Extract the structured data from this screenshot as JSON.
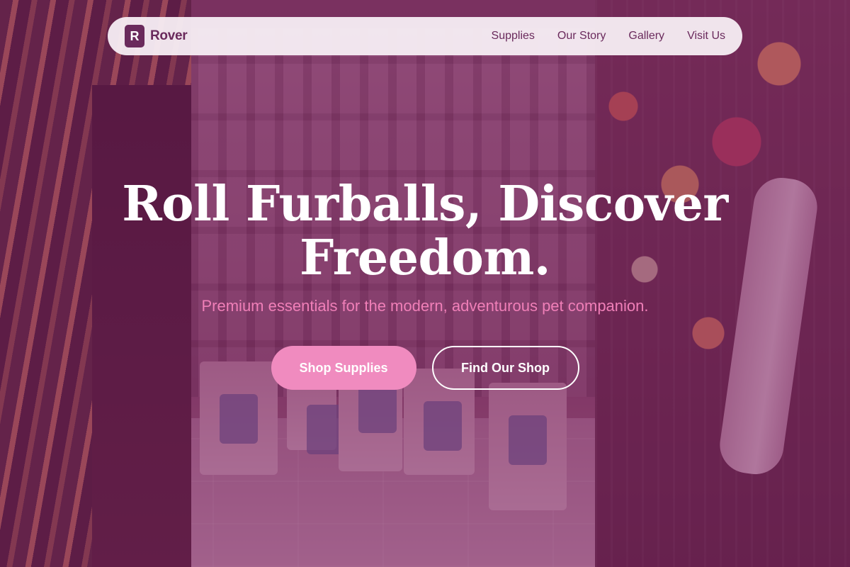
{
  "brand": {
    "logo_letter": "R",
    "name": "Rover"
  },
  "nav": {
    "links": [
      {
        "label": "Supplies"
      },
      {
        "label": "Our Story"
      },
      {
        "label": "Gallery"
      },
      {
        "label": "Visit Us"
      }
    ]
  },
  "hero": {
    "title": "Roll Furballs, Discover Freedom.",
    "subtitle": "Premium essentials for the modern, adventurous pet companion.",
    "primary_cta": "Shop Supplies",
    "secondary_cta": "Find Our Shop"
  },
  "colors": {
    "brand": "#6a2a5c",
    "accent_pink": "#f08bbf",
    "subtitle_pink": "#f07fb8",
    "overlay": "#7a1e5c",
    "nav_background": "#f7eef4"
  }
}
